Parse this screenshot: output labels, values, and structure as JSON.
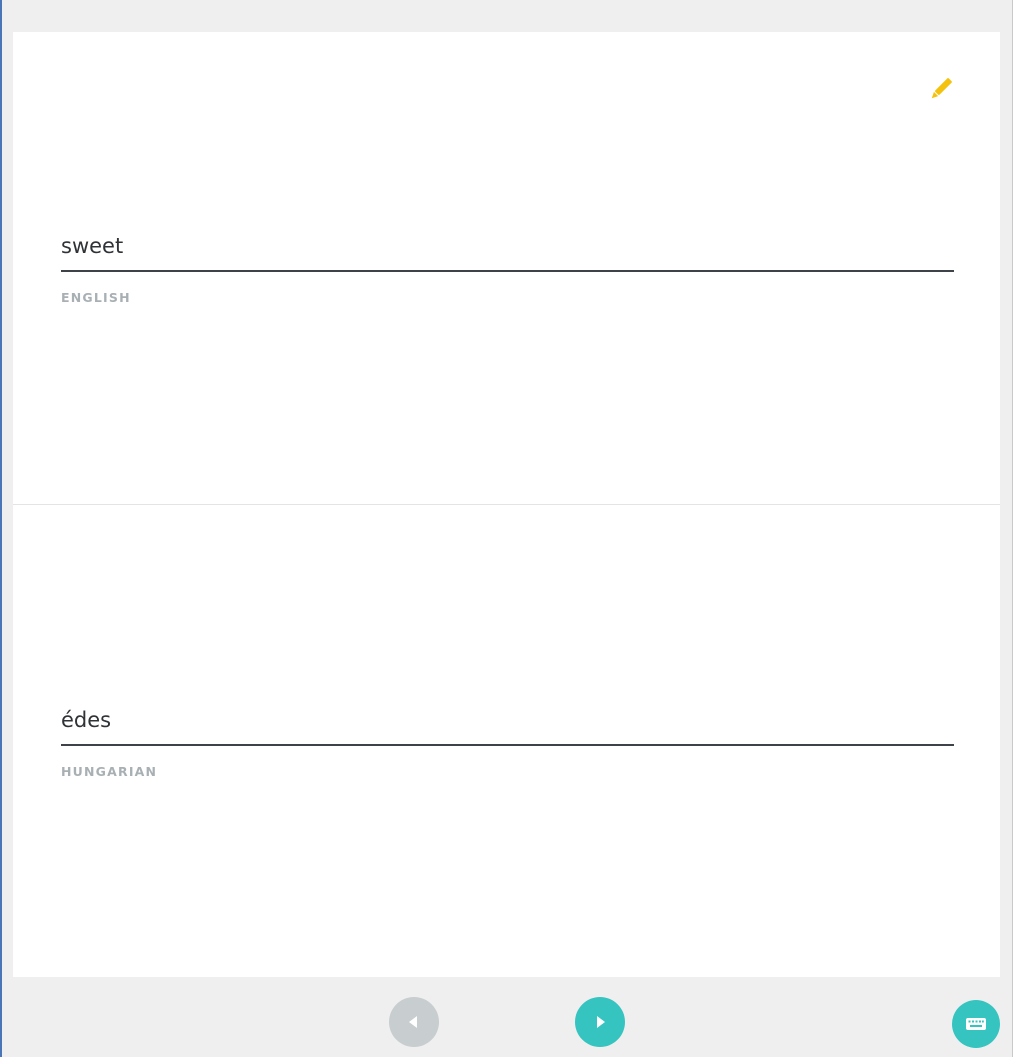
{
  "card": {
    "front": {
      "value": "sweet",
      "language": "ENGLISH"
    },
    "back": {
      "value": "édes",
      "language": "HUNGARIAN"
    }
  },
  "icons": {
    "edit": "pencil-icon",
    "previous": "chevron-left-icon",
    "next": "chevron-right-icon",
    "keyboard": "keyboard-icon"
  },
  "colors": {
    "accent": "#35c4bf",
    "edit": "#f4c20d",
    "disabled": "#c8cdd0",
    "underline": "#3d4348",
    "label": "#a8b0b4",
    "background": "#efefef"
  },
  "navigation": {
    "previous_enabled": false,
    "next_enabled": true
  }
}
